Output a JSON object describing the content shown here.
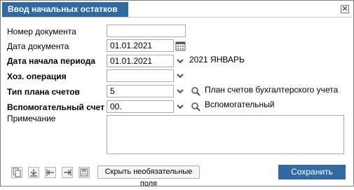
{
  "dialog": {
    "title": "Ввод начальных остатков",
    "close_symbol": "✕"
  },
  "form": {
    "doc_number": {
      "label": "Номер документа",
      "value": ""
    },
    "doc_date": {
      "label": "Дата документа",
      "value": "01.01.2021"
    },
    "period_start": {
      "label": "Дата начала периода",
      "value": "01.01.2021",
      "side_text": "2021 ЯНВАРЬ"
    },
    "operation": {
      "label": "Хоз. операция",
      "value": ""
    },
    "chart_type": {
      "label": "Тип плана счетов",
      "value": "5",
      "side_text": "План счетов бухгалтерского учета"
    },
    "aux_account": {
      "label": "Вспомогательный счет",
      "value": "00.",
      "side_text": "Вспомогательный"
    },
    "note": {
      "label": "Примечание",
      "value": ""
    }
  },
  "toolbar": {
    "icons": [
      "copy-icon",
      "import-icon",
      "back-icon",
      "forward-icon",
      "save-disk-icon"
    ],
    "hide_fields_label": "Скрыть необязательные поля",
    "save_label": "Сохранить"
  },
  "colors": {
    "accent": "#2f6aa3",
    "icon": "#4a4a4a"
  }
}
